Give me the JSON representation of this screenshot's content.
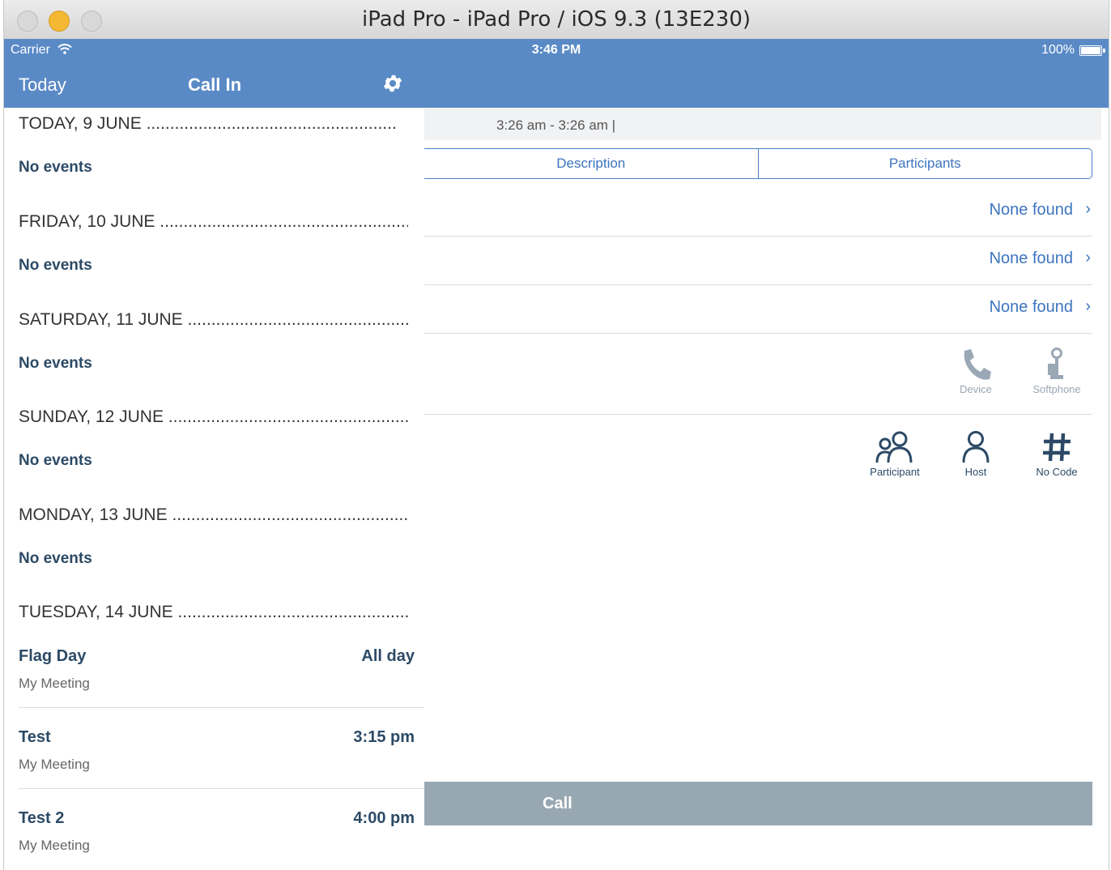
{
  "window": {
    "title": "iPad Pro - iPad Pro / iOS 9.3 (13E230)"
  },
  "status": {
    "carrier": "Carrier",
    "time": "3:46 PM",
    "battery": "100%"
  },
  "nav": {
    "today": "Today",
    "title": "Call In",
    "settings_icon": "gear-icon"
  },
  "detail": {
    "time_range": "3:26 am - 3:26 am |",
    "tabs": [
      "Description",
      "Participants"
    ],
    "rows": [
      "None found",
      "None found",
      "None found"
    ],
    "call_via": [
      {
        "label": "Device",
        "icon": "phone-icon"
      },
      {
        "label": "Softphone",
        "icon": "softphone-icon"
      }
    ],
    "join_as": [
      {
        "label": "Participant",
        "icon": "participants-icon"
      },
      {
        "label": "Host",
        "icon": "host-icon"
      },
      {
        "label": "No Code",
        "icon": "hash-icon"
      }
    ],
    "call_label": "Call"
  },
  "agenda": {
    "days": [
      {
        "label": "TODAY, 9 JUNE",
        "no_events": "No events"
      },
      {
        "label": "FRIDAY, 10 JUNE",
        "no_events": "No events"
      },
      {
        "label": "SATURDAY, 11 JUNE",
        "no_events": "No events"
      },
      {
        "label": "SUNDAY, 12 JUNE",
        "no_events": "No events"
      },
      {
        "label": "MONDAY, 13 JUNE",
        "no_events": "No events"
      },
      {
        "label": "TUESDAY, 14 JUNE"
      }
    ],
    "events": [
      {
        "title": "Flag Day",
        "time": "All day",
        "subtitle": "My Meeting"
      },
      {
        "title": "Test",
        "time": "3:15 pm",
        "subtitle": "My Meeting"
      },
      {
        "title": "Test 2",
        "time": "4:00 pm",
        "subtitle": "My Meeting"
      }
    ]
  },
  "colors": {
    "accent": "#5a8ac6",
    "link": "#3d74bf",
    "dark_text": "#2c4a66",
    "call_button": "#98a8b3"
  }
}
